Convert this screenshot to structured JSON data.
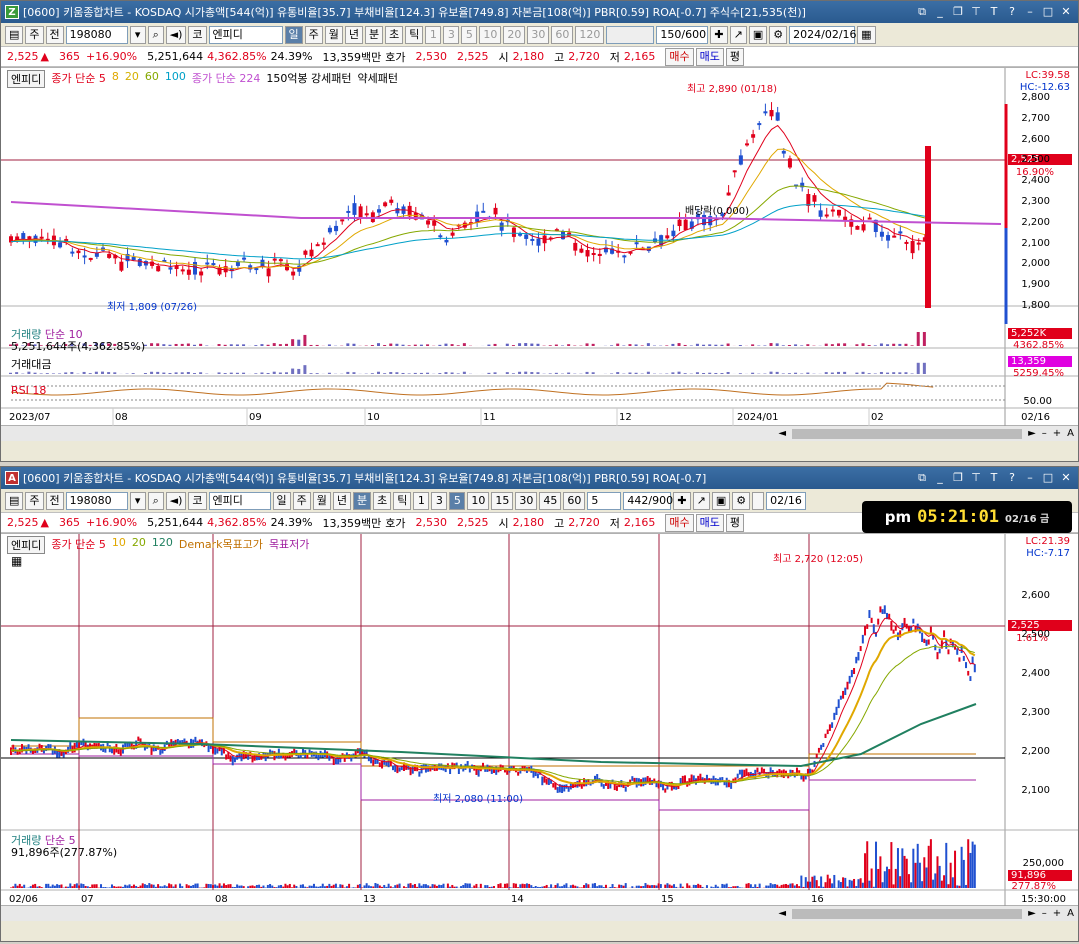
{
  "top": {
    "title": "[0600] 키움종합차트 - KOSDAQ 시가총액[544(억)] 유통비율[35.7] 부채비율[124.3] 유보율[749.8] 자본금[108(억)] PBR[0.59] ROA[-0.7] 주식수[21,535(천)]",
    "app_icon": "Z",
    "toolbar": {
      "type1": "주",
      "type2": "전",
      "code": "198080",
      "name": "엔피디",
      "periods": [
        "일",
        "주",
        "월",
        "년",
        "분",
        "초",
        "틱"
      ],
      "nums": [
        "1",
        "3",
        "5",
        "10",
        "20",
        "30",
        "60",
        "120"
      ],
      "count": "150/600",
      "date": "2024/02/16"
    },
    "quote": {
      "price": "2,525",
      "change": "365",
      "rate": "+16.90%",
      "volume": "5,251,644",
      "vol_rate": "4,362.85%",
      "turnover": "24.39%",
      "amount": "13,359백만",
      "hoga_label": "호가",
      "ask": "2,530",
      "bid": "2,525",
      "open_label": "시",
      "open": "2,180",
      "high_label": "고",
      "high": "2,720",
      "low_label": "저",
      "low": "2,165",
      "buy": "매수",
      "sell": "매도",
      "avg": "평"
    },
    "legend": {
      "name": "엔피디",
      "ma": "종가 단순 5",
      "ma8": "8",
      "ma20": "20",
      "ma60": "60",
      "ma100": "100",
      "ma224": "종가 단순 224",
      "pattern": "150억봉 강세패턴",
      "pattern2": "약세패턴"
    },
    "lc": "LC:39.58",
    "hc": "HC:-12.63",
    "price_tag": "2,525",
    "pct_tag": "16.90%",
    "high_note": "최고 2,890 (01/18)",
    "low_note": "최저 1,809 (07/26)",
    "div_note": "배당락(0.000)",
    "y_ticks": [
      "2,800",
      "2,700",
      "2,600",
      "2,500",
      "2,400",
      "2,300",
      "2,200",
      "2,100",
      "2,000",
      "1,900",
      "1,800"
    ],
    "vol_label": "거래량",
    "vol_ma": "단순 10",
    "vol_value": "5,251,644주(4,362.85%)",
    "vol_tag": "5,252K",
    "vol_tag2": "4362.85%",
    "amt_label": "거래대금",
    "amt_tag": "13,359",
    "amt_tag2": "5259.45%",
    "rsi_label": "RSI 18",
    "rsi_tick": "50.00",
    "x_labels": [
      "2023/07",
      "08",
      "09",
      "10",
      "11",
      "12",
      "2024/01",
      "02"
    ],
    "x_right": "02/16"
  },
  "bottom": {
    "title": "[0600] 키움종합차트 - KOSDAQ 시가총액[544(억)] 유통비율[35.7] 부채비율[124.3] 유보율[749.8] 자본금[108(억)] PBR[0.59] ROA[-0.7]",
    "app_icon": "A",
    "toolbar": {
      "type1": "주",
      "type2": "전",
      "code": "198080",
      "name": "엔피디",
      "periods": [
        "일",
        "주",
        "월",
        "년",
        "분",
        "초",
        "틱"
      ],
      "nums": [
        "1",
        "3",
        "5",
        "10",
        "15",
        "30",
        "45",
        "60"
      ],
      "interval": "5",
      "count": "442/900",
      "date": "02/16"
    },
    "clock": {
      "ampm": "pm",
      "time": "05:21:01",
      "date": "02/16 금"
    },
    "legend": {
      "name": "엔피디",
      "ma": "종가 단순 5",
      "ma10": "10",
      "ma20": "20",
      "ma120": "120",
      "demark": "Demark목표고가",
      "demark2": "목표저가"
    },
    "lc": "LC:21.39",
    "hc": "HC:-7.17",
    "price_tag": "2,525",
    "pct_tag": "1.61%",
    "high_note": "최고 2,720 (12:05)",
    "low_note": "최저 2,080 (11:00)",
    "y_ticks": [
      "2,600",
      "2,500",
      "2,400",
      "2,300",
      "2,200",
      "2,100"
    ],
    "vol_label": "거래량",
    "vol_ma": "단순 5",
    "vol_value": "91,896주(277.87%)",
    "vol_tag": "91,896",
    "vol_tag2": "277.87%",
    "vol_tick": "250,000",
    "x_labels": [
      "02/06",
      "07",
      "08",
      "13",
      "14",
      "15",
      "16"
    ],
    "x_right": "15:30:00"
  }
}
